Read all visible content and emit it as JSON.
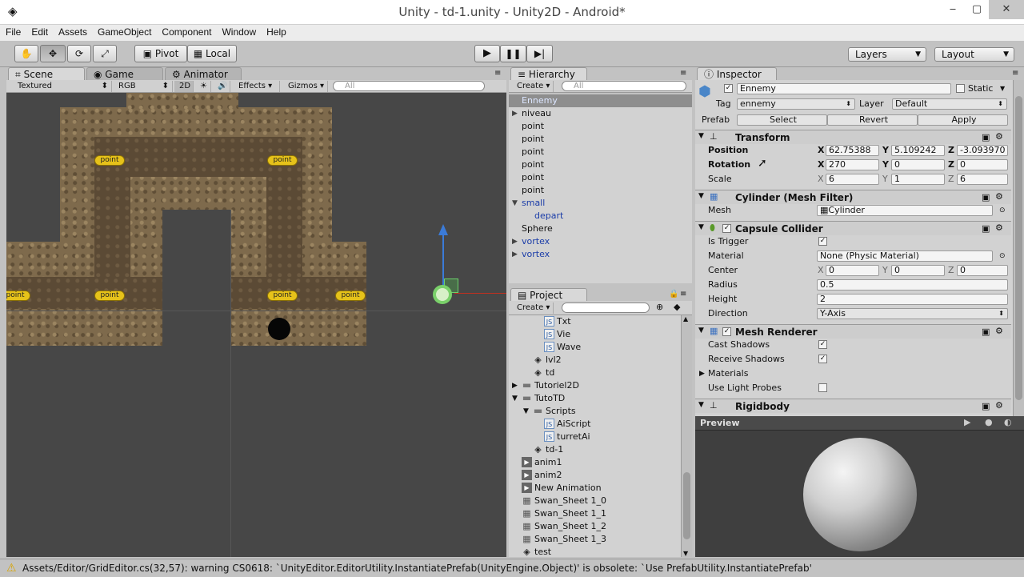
{
  "window": {
    "title": "Unity - td-1.unity - Unity2D - Android*",
    "minimize": "‒",
    "maximize": "▢",
    "close": "✕"
  },
  "menu": [
    "File",
    "Edit",
    "Assets",
    "GameObject",
    "Component",
    "Window",
    "Help"
  ],
  "toolbar": {
    "pivot": "Pivot",
    "local": "Local",
    "layers": "Layers",
    "layout": "Layout"
  },
  "scene_tabs": {
    "scene": "Scene",
    "game": "Game",
    "animator": "Animator"
  },
  "scene_toolbar": {
    "shading": "Textured",
    "render": "RGB",
    "mode2d": "2D",
    "effects": "Effects",
    "gizmos": "Gizmos",
    "search_placeholder": "All"
  },
  "scene_points": [
    "point",
    "point",
    "point",
    "point",
    "point",
    "point"
  ],
  "hierarchy": {
    "tab": "Hierarchy",
    "create": "Create",
    "search_placeholder": "All",
    "items": [
      {
        "label": "Ennemy",
        "arrow": ""
      },
      {
        "label": "niveau",
        "arrow": "▶"
      },
      {
        "label": "point",
        "arrow": ""
      },
      {
        "label": "point",
        "arrow": ""
      },
      {
        "label": "point",
        "arrow": ""
      },
      {
        "label": "point",
        "arrow": ""
      },
      {
        "label": "point",
        "arrow": ""
      },
      {
        "label": "point",
        "arrow": ""
      },
      {
        "label": "small",
        "arrow": "▼"
      },
      {
        "label": "depart",
        "arrow": ""
      },
      {
        "label": "Sphere",
        "arrow": ""
      },
      {
        "label": "vortex",
        "arrow": "▶"
      },
      {
        "label": "vortex",
        "arrow": "▶"
      }
    ]
  },
  "project": {
    "tab": "Project",
    "create": "Create",
    "items": [
      {
        "label": "Txt",
        "icon": "JS"
      },
      {
        "label": "Vie",
        "icon": "JS"
      },
      {
        "label": "Wave",
        "icon": "JS"
      },
      {
        "label": "lvl2",
        "icon": "unity"
      },
      {
        "label": "td",
        "icon": "unity"
      },
      {
        "label": "Tutoriel2D",
        "icon": "folder"
      },
      {
        "label": "TutoTD",
        "icon": "folder"
      },
      {
        "label": "Scripts",
        "icon": "folder"
      },
      {
        "label": "AiScript",
        "icon": "JS"
      },
      {
        "label": "turretAi",
        "icon": "JS"
      },
      {
        "label": "td-1",
        "icon": "unity"
      },
      {
        "label": "anim1",
        "icon": "anim"
      },
      {
        "label": "anim2",
        "icon": "anim"
      },
      {
        "label": "New Animation",
        "icon": "anim"
      },
      {
        "label": "Swan_Sheet 1_0",
        "icon": "sprite"
      },
      {
        "label": "Swan_Sheet 1_1",
        "icon": "sprite"
      },
      {
        "label": "Swan_Sheet 1_2",
        "icon": "sprite"
      },
      {
        "label": "Swan_Sheet 1_3",
        "icon": "sprite"
      },
      {
        "label": "test",
        "icon": "unity"
      }
    ]
  },
  "inspector": {
    "tab": "Inspector",
    "name": "Ennemy",
    "static": "Static",
    "tag_label": "Tag",
    "tag": "ennemy",
    "layer_label": "Layer",
    "layer": "Default",
    "prefab_label": "Prefab",
    "select": "Select",
    "revert": "Revert",
    "apply": "Apply",
    "transform": {
      "title": "Transform",
      "position": {
        "label": "Position",
        "x": "62.75388",
        "y": "5.109242",
        "z": "-3.093970"
      },
      "rotation": {
        "label": "Rotation",
        "x": "270",
        "y": "0",
        "z": "0"
      },
      "scale": {
        "label": "Scale",
        "x": "6",
        "y": "1",
        "z": "6"
      }
    },
    "mesh_filter": {
      "title": "Cylinder (Mesh Filter)",
      "mesh_label": "Mesh",
      "mesh": "Cylinder"
    },
    "collider": {
      "title": "Capsule Collider",
      "is_trigger": "Is Trigger",
      "material_label": "Material",
      "material": "None (Physic Material)",
      "center_label": "Center",
      "cx": "0",
      "cy": "0",
      "cz": "0",
      "radius_label": "Radius",
      "radius": "0.5",
      "height_label": "Height",
      "height": "2",
      "direction_label": "Direction",
      "direction": "Y-Axis"
    },
    "renderer": {
      "title": "Mesh Renderer",
      "cast": "Cast Shadows",
      "receive": "Receive Shadows",
      "materials": "Materials",
      "light_probes": "Use Light Probes"
    },
    "rigidbody": {
      "title": "Rigidbody"
    },
    "axis": {
      "x": "X",
      "y": "Y",
      "z": "Z"
    }
  },
  "preview": {
    "title": "Preview"
  },
  "status": {
    "message": "Assets/Editor/GridEditor.cs(32,57): warning CS0618: `UnityEditor.EditorUtility.InstantiatePrefab(UnityEngine.Object)' is obsolete: `Use PrefabUtility.InstantiatePrefab'"
  },
  "colors": {
    "accent_blue": "#1a3ca8",
    "selection": "#8e8e8e",
    "point_badge": "#e6c21a"
  }
}
